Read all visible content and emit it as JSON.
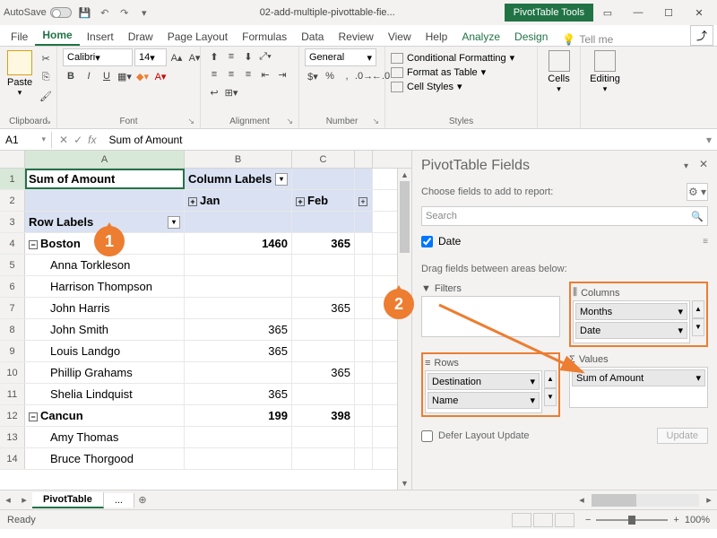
{
  "titlebar": {
    "autosave": "AutoSave",
    "filename": "02-add-multiple-pivottable-fie...",
    "tools": "PivotTable Tools"
  },
  "tabs": {
    "file": "File",
    "home": "Home",
    "insert": "Insert",
    "draw": "Draw",
    "pagelayout": "Page Layout",
    "formulas": "Formulas",
    "data": "Data",
    "review": "Review",
    "view": "View",
    "help": "Help",
    "analyze": "Analyze",
    "design": "Design",
    "tellme": "Tell me"
  },
  "ribbon": {
    "clipboard": "Clipboard",
    "paste": "Paste",
    "font": "Font",
    "fontname": "Calibri",
    "fontsize": "14",
    "alignment": "Alignment",
    "number": "Number",
    "numberformat": "General",
    "styles": "Styles",
    "condfmt": "Conditional Formatting",
    "fmttable": "Format as Table",
    "cellstyles": "Cell Styles",
    "cells": "Cells",
    "editing": "Editing"
  },
  "namebox": "A1",
  "formula": "Sum of Amount",
  "columns": {
    "A": "A",
    "B": "B",
    "C": "C"
  },
  "grid": {
    "r1A": "Sum of Amount",
    "r1B": "Column Labels",
    "r2B": "Jan",
    "r2C": "Feb",
    "r3A": "Row Labels",
    "r4A": "Boston",
    "r4B": "1460",
    "r4C": "365",
    "r5A": "Anna Torkleson",
    "r6A": "Harrison Thompson",
    "r7A": "John Harris",
    "r7C": "365",
    "r8A": "John Smith",
    "r8B": "365",
    "r9A": "Louis Landgo",
    "r9B": "365",
    "r10A": "Phillip Grahams",
    "r10C": "365",
    "r11A": "Shelia Lindquist",
    "r11B": "365",
    "r12A": "Cancun",
    "r12B": "199",
    "r12C": "398",
    "r13A": "Amy Thomas",
    "r14A": "Bruce Thorgood"
  },
  "sheettab": "PivotTable",
  "fieldpane": {
    "title": "PivotTable Fields",
    "choose": "Choose fields to add to report:",
    "search": "Search",
    "date": "Date",
    "drag": "Drag fields between areas below:",
    "filters": "Filters",
    "columns": "Columns",
    "rows": "Rows",
    "values": "Values",
    "months": "Months",
    "datef": "Date",
    "destination": "Destination",
    "name": "Name",
    "sumamount": "Sum of Amount",
    "defer": "Defer Layout Update",
    "update": "Update"
  },
  "status": {
    "ready": "Ready",
    "zoom": "100%"
  },
  "callouts": {
    "c1": "1",
    "c2": "2"
  }
}
